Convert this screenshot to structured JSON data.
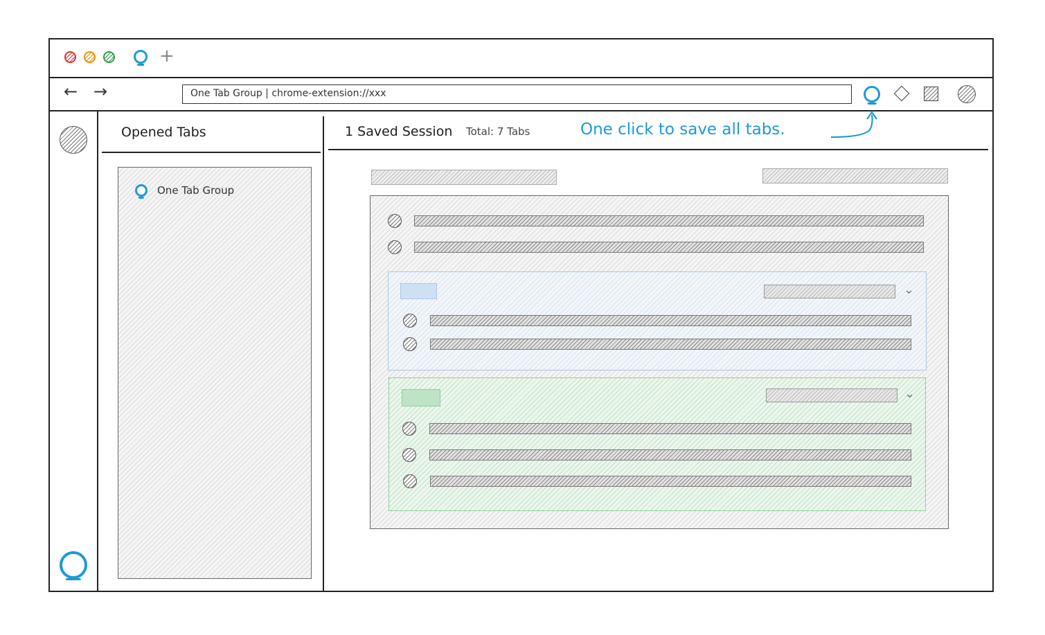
{
  "titlebar": {
    "traffic_colors": [
      "#e03131",
      "#f08c00",
      "#2f9e44"
    ],
    "tab_icon": "one-tab-group-icon",
    "new_tab_label": "+"
  },
  "navbar": {
    "back_label": "←",
    "forward_label": "→",
    "url": "One Tab Group | chrome-extension://xxx",
    "extension_icons": [
      "one-tab-group-icon",
      "diamond-icon",
      "square-icon",
      "circle-icon"
    ]
  },
  "sidebar": {
    "top_icon": "avatar-icon",
    "bottom_icon": "one-tab-group-icon"
  },
  "opened_tabs": {
    "title": "Opened Tabs",
    "items": [
      {
        "label": "One Tab Group",
        "icon": "one-tab-group-icon"
      }
    ]
  },
  "sessions": {
    "title": "1 Saved Session",
    "total": "Total: 7 Tabs",
    "annotation": "One click to save all tabs.",
    "accent_color": "#1c9ad6",
    "groups": [
      {
        "color": "#a9c6e8",
        "tab_count": 2
      },
      {
        "color": "#8fcf99",
        "tab_count": 3
      }
    ],
    "ungrouped_tab_count": 2
  }
}
